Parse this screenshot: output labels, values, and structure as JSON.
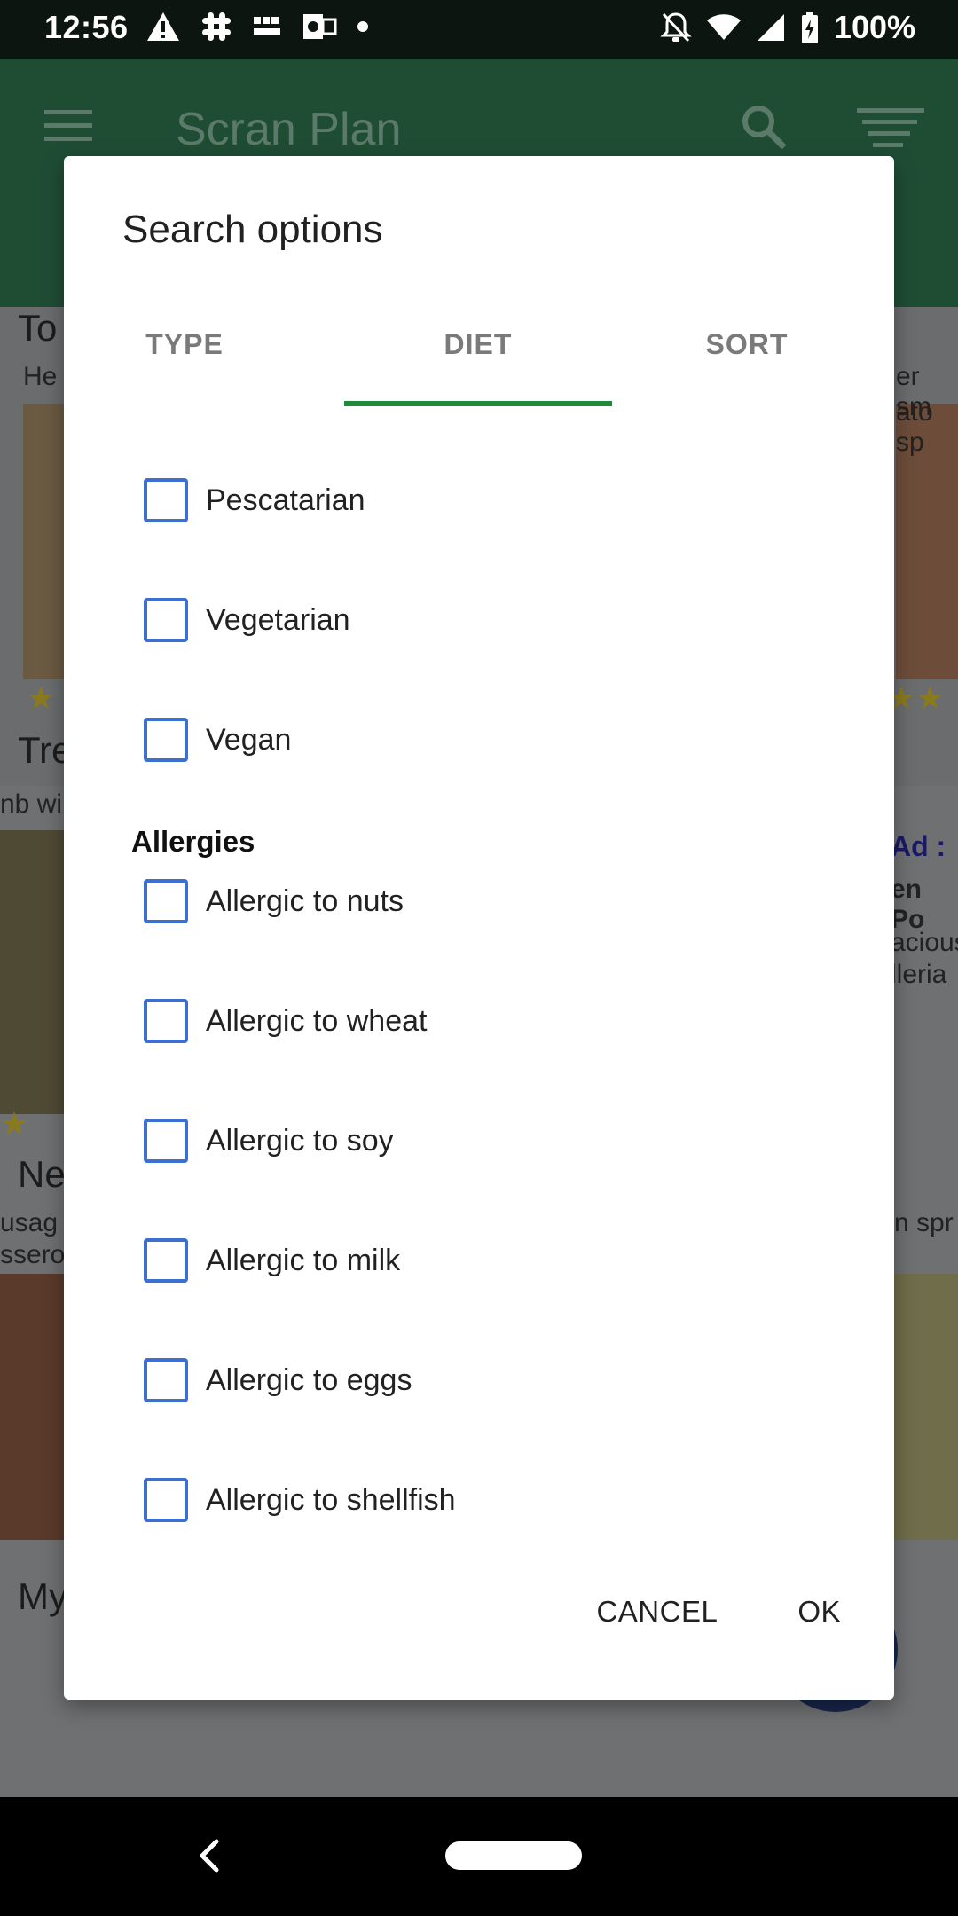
{
  "status_bar": {
    "time": "12:56",
    "battery": "100%",
    "left_icons": [
      "warning-icon",
      "slack-icon",
      "bbc-news-icon",
      "outlook-icon",
      "dot-icon"
    ],
    "right_icons": [
      "notifications-off-icon",
      "wifi-icon",
      "signal-icon",
      "battery-charging-icon"
    ]
  },
  "app_bar": {
    "title": "Scran Plan",
    "icons": [
      "menu-icon",
      "search-icon",
      "filter-icon"
    ]
  },
  "background": {
    "items": [
      {
        "title": "To",
        "subtitle": "He"
      },
      {
        "title": "Tre",
        "subtitle": "nb wi"
      },
      {
        "title": "Ne",
        "subtitle": "usag",
        "subtitle2": "ssero"
      },
      {
        "title": "My"
      }
    ],
    "right_snippets": [
      "er sm",
      "ato sp",
      "en Po",
      "acious",
      "lleria",
      "n spr"
    ],
    "ad_label": "Ad : "
  },
  "dialog": {
    "title": "Search options",
    "tabs": [
      {
        "label": "TYPE",
        "selected": false
      },
      {
        "label": "DIET",
        "selected": true
      },
      {
        "label": "SORT",
        "selected": false
      }
    ],
    "diet_options": [
      {
        "label": "Pescatarian",
        "checked": false
      },
      {
        "label": "Vegetarian",
        "checked": false
      },
      {
        "label": "Vegan",
        "checked": false
      }
    ],
    "allergies_heading": "Allergies",
    "allergy_options": [
      {
        "label": "Allergic to nuts",
        "checked": false
      },
      {
        "label": "Allergic to wheat",
        "checked": false
      },
      {
        "label": "Allergic to soy",
        "checked": false
      },
      {
        "label": "Allergic to milk",
        "checked": false
      },
      {
        "label": "Allergic to eggs",
        "checked": false
      },
      {
        "label": "Allergic to shellfish",
        "checked": false
      }
    ],
    "cancel_label": "CANCEL",
    "ok_label": "OK"
  },
  "colors": {
    "accent": "#1e8a3a",
    "checkbox": "#3b6fd1",
    "app_bar": "#1f4d34"
  }
}
